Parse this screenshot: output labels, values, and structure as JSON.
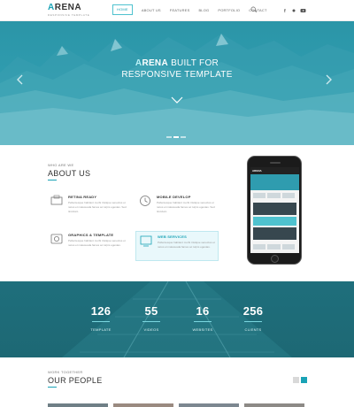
{
  "header": {
    "logo_prefix": "A",
    "logo_rest": "RENA",
    "logo_tagline": "RESPONSIVE TEMPLATE",
    "nav": [
      "HOME",
      "ABOUT US",
      "FEATURES",
      "BLOG",
      "PORTFOLIO",
      "CONTACT"
    ],
    "active_nav": "HOME",
    "social_icons": [
      "facebook-icon",
      "twitter-icon",
      "youtube-icon"
    ]
  },
  "hero": {
    "title_accent": "A",
    "title_bold": "RENA",
    "title_rest": " BUILT FOR",
    "subtitle": "RESPONSIVE TEMPLATE",
    "slides": 3,
    "active_slide": 2
  },
  "about": {
    "kicker": "WHO ARE WE",
    "title": "ABOUT US",
    "features": [
      {
        "title": "RETINA READY",
        "desc": "Pellentesque habitant morbi tristique senectus et netus et malesuada fames ac turpis egestas. Sed tincidunt.",
        "icon": "retina-icon"
      },
      {
        "title": "MOBILE DEVELOP",
        "desc": "Pellentesque habitant morbi tristique senectus et netus et malesuada fames ac turpis egestas. Sed tincidunt.",
        "icon": "clock-icon"
      },
      {
        "title": "GRAPHICS & TEMPLATE",
        "desc": "Pellentesque habitant morbi tristique senectus et netus et malesuada fames ac turpis egestas.",
        "icon": "graphics-icon"
      },
      {
        "title": "WEB SERVICES",
        "desc": "Pellentesque habitant morbi tristique senectus et netus et malesuada fames ac turpis egestas.",
        "icon": "web-services-icon"
      }
    ],
    "phone_screen_logo": "ARENA"
  },
  "stats": [
    {
      "num": "126",
      "label": "TEMPLATE"
    },
    {
      "num": "55",
      "label": "VIDEOS"
    },
    {
      "num": "16",
      "label": "WEBSITES"
    },
    {
      "num": "256",
      "label": "CLIENTS"
    }
  ],
  "people": {
    "kicker": "WORK TOGETHER",
    "title": "OUR PEOPLE"
  },
  "colors": {
    "accent": "#1aa3b6",
    "hero": "#2f9caf",
    "stats_bg": "#1f6f7c"
  }
}
